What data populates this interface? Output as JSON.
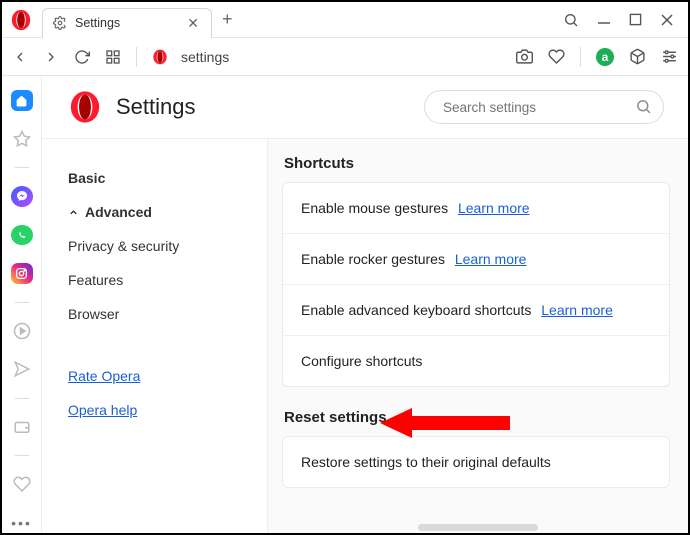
{
  "window": {
    "tab_title": "Settings",
    "address_text": "settings"
  },
  "header": {
    "title": "Settings",
    "search_placeholder": "Search settings"
  },
  "nav": {
    "basic": "Basic",
    "advanced": "Advanced",
    "privacy": "Privacy & security",
    "features": "Features",
    "browser": "Browser",
    "rate": "Rate Opera",
    "help": "Opera help"
  },
  "sections": {
    "shortcuts": {
      "title": "Shortcuts",
      "rows": {
        "mouse": "Enable mouse gestures",
        "rocker": "Enable rocker gestures",
        "keyboard": "Enable advanced keyboard shortcuts",
        "configure": "Configure shortcuts"
      },
      "learn_more": "Learn more"
    },
    "reset": {
      "title": "Reset settings",
      "restore": "Restore settings to their original defaults"
    }
  }
}
